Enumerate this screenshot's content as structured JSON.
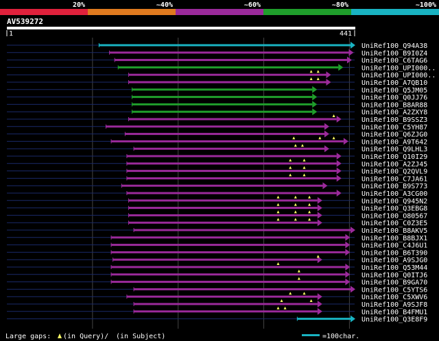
{
  "scale": {
    "ticks": [
      "20%",
      "~40%",
      "~60%",
      "~80%",
      "~100%"
    ],
    "segment_colors": [
      "#e0213c",
      "#e07a1f",
      "#9b2a9b",
      "#1f9e2b",
      "#19b3c2"
    ]
  },
  "query": {
    "name": "AV539272",
    "start_label": "1",
    "end_label": "441"
  },
  "hits": [
    {
      "name": "UniRef100_Q94A38",
      "color": "#19b3c2",
      "coverage": 1.0,
      "start": 0.265,
      "end": 1.0,
      "gaps": []
    },
    {
      "name": "UniRef100_B9I0Z4",
      "color": "#9b2a9b",
      "coverage": 0.88,
      "start": 0.295,
      "end": 0.995,
      "gaps": []
    },
    {
      "name": "UniRef100_C6TAG6",
      "color": "#9b2a9b",
      "coverage": 0.85,
      "start": 0.31,
      "end": 0.99,
      "gaps": []
    },
    {
      "name": "UniRef100_UPI000..",
      "color": "#1f9e2b",
      "coverage": 0.78,
      "start": 0.32,
      "end": 0.965,
      "gaps": []
    },
    {
      "name": "UniRef100_UPI000..",
      "color": "#9b2a9b",
      "coverage": 0.75,
      "start": 0.35,
      "end": 0.93,
      "gaps": [
        0.875,
        0.895
      ]
    },
    {
      "name": "UniRef100_A7QB10",
      "color": "#9b2a9b",
      "coverage": 0.72,
      "start": 0.35,
      "end": 0.93,
      "gaps": [
        0.875,
        0.895
      ]
    },
    {
      "name": "UniRef100_Q5JM05",
      "color": "#1f9e2b",
      "coverage": 0.7,
      "start": 0.36,
      "end": 0.89,
      "gaps": []
    },
    {
      "name": "UniRef100_Q0JJ76",
      "color": "#1f9e2b",
      "coverage": 0.7,
      "start": 0.36,
      "end": 0.89,
      "gaps": []
    },
    {
      "name": "UniRef100_B8AR88",
      "color": "#1f9e2b",
      "coverage": 0.7,
      "start": 0.36,
      "end": 0.89,
      "gaps": []
    },
    {
      "name": "UniRef100_A2ZXY8",
      "color": "#1f9e2b",
      "coverage": 0.7,
      "start": 0.36,
      "end": 0.89,
      "gaps": []
    },
    {
      "name": "UniRef100_B9SSZ3",
      "color": "#9b2a9b",
      "coverage": 0.74,
      "start": 0.35,
      "end": 0.96,
      "gaps": [
        0.94
      ]
    },
    {
      "name": "UniRef100_C5YH87",
      "color": "#9b2a9b",
      "coverage": 0.71,
      "start": 0.285,
      "end": 0.925,
      "gaps": []
    },
    {
      "name": "UniRef100_Q6ZJG0",
      "color": "#9b2a9b",
      "coverage": 0.7,
      "start": 0.34,
      "end": 0.925,
      "gaps": []
    },
    {
      "name": "UniRef100_A9T642",
      "color": "#9b2a9b",
      "coverage": 0.69,
      "start": 0.3,
      "end": 0.98,
      "gaps": [
        0.825,
        0.9,
        0.94
      ]
    },
    {
      "name": "UniRef100_Q9LHL3",
      "color": "#9b2a9b",
      "coverage": 0.68,
      "start": 0.365,
      "end": 0.925,
      "gaps": [
        0.83,
        0.85
      ]
    },
    {
      "name": "UniRef100_Q10I29",
      "color": "#9b2a9b",
      "coverage": 0.67,
      "start": 0.345,
      "end": 0.96,
      "gaps": []
    },
    {
      "name": "UniRef100_A2ZJ45",
      "color": "#9b2a9b",
      "coverage": 0.67,
      "start": 0.345,
      "end": 0.96,
      "gaps": [
        0.815,
        0.855
      ]
    },
    {
      "name": "UniRef100_Q2QVL9",
      "color": "#9b2a9b",
      "coverage": 0.67,
      "start": 0.345,
      "end": 0.96,
      "gaps": [
        0.815,
        0.855
      ]
    },
    {
      "name": "UniRef100_C7JA61",
      "color": "#9b2a9b",
      "coverage": 0.67,
      "start": 0.345,
      "end": 0.96,
      "gaps": [
        0.815,
        0.855
      ]
    },
    {
      "name": "UniRef100_B9S773",
      "color": "#9b2a9b",
      "coverage": 0.66,
      "start": 0.33,
      "end": 0.92,
      "gaps": []
    },
    {
      "name": "UniRef100_A3CG00",
      "color": "#9b2a9b",
      "coverage": 0.66,
      "start": 0.345,
      "end": 0.96,
      "gaps": []
    },
    {
      "name": "UniRef100_Q945N2",
      "color": "#9b2a9b",
      "coverage": 0.64,
      "start": 0.35,
      "end": 0.905,
      "gaps": [
        0.78,
        0.83,
        0.87
      ]
    },
    {
      "name": "UniRef100_Q3EBG8",
      "color": "#9b2a9b",
      "coverage": 0.64,
      "start": 0.35,
      "end": 0.905,
      "gaps": [
        0.78,
        0.83,
        0.87
      ]
    },
    {
      "name": "UniRef100_O80567",
      "color": "#9b2a9b",
      "coverage": 0.64,
      "start": 0.35,
      "end": 0.905,
      "gaps": [
        0.78,
        0.83,
        0.87
      ]
    },
    {
      "name": "UniRef100_C0Z3E5",
      "color": "#9b2a9b",
      "coverage": 0.64,
      "start": 0.35,
      "end": 0.905,
      "gaps": [
        0.78,
        0.83,
        0.87
      ]
    },
    {
      "name": "UniRef100_B8AKV5",
      "color": "#9b2a9b",
      "coverage": 0.63,
      "start": 0.365,
      "end": 1.0,
      "gaps": []
    },
    {
      "name": "UniRef100_B8BJX1",
      "color": "#9b2a9b",
      "coverage": 0.62,
      "start": 0.3,
      "end": 0.985,
      "gaps": []
    },
    {
      "name": "UniRef100_C4J6U1",
      "color": "#9b2a9b",
      "coverage": 0.62,
      "start": 0.3,
      "end": 0.985,
      "gaps": []
    },
    {
      "name": "UniRef100_B6T390",
      "color": "#9b2a9b",
      "coverage": 0.62,
      "start": 0.3,
      "end": 0.985,
      "gaps": []
    },
    {
      "name": "UniRef100_A9SJG0",
      "color": "#9b2a9b",
      "coverage": 0.6,
      "start": 0.305,
      "end": 0.905,
      "gaps": [
        0.895
      ]
    },
    {
      "name": "UniRef100_Q53M44",
      "color": "#9b2a9b",
      "coverage": 0.6,
      "start": 0.3,
      "end": 0.985,
      "gaps": [
        0.78
      ]
    },
    {
      "name": "UniRef100_Q0ITJ6",
      "color": "#9b2a9b",
      "coverage": 0.6,
      "start": 0.3,
      "end": 0.985,
      "gaps": [
        0.84
      ]
    },
    {
      "name": "UniRef100_B9GA70",
      "color": "#9b2a9b",
      "coverage": 0.6,
      "start": 0.3,
      "end": 0.985,
      "gaps": [
        0.84
      ]
    },
    {
      "name": "UniRef100_C5YTS6",
      "color": "#9b2a9b",
      "coverage": 0.58,
      "start": 0.365,
      "end": 1.0,
      "gaps": []
    },
    {
      "name": "UniRef100_C5XWV6",
      "color": "#9b2a9b",
      "coverage": 0.58,
      "start": 0.345,
      "end": 0.905,
      "gaps": [
        0.815,
        0.855
      ]
    },
    {
      "name": "UniRef100_A9SJF8",
      "color": "#9b2a9b",
      "coverage": 0.57,
      "start": 0.365,
      "end": 0.905,
      "gaps": [
        0.79,
        0.875
      ]
    },
    {
      "name": "UniRef100_B4FMU1",
      "color": "#9b2a9b",
      "coverage": 0.57,
      "start": 0.365,
      "end": 0.905,
      "gaps": [
        0.78,
        0.8
      ]
    },
    {
      "name": "UniRef100_Q3E8F9",
      "color": "#19b3c2",
      "coverage": 0.55,
      "start": 0.835,
      "end": 1.0,
      "gaps": []
    }
  ],
  "legend": {
    "gaps_prefix": "Large gaps:",
    "gaps_query": "(in Query)/",
    "gaps_subject": "(in Subject)",
    "scale_bar": "=100char.",
    "scale_color": "#19b3c2"
  }
}
